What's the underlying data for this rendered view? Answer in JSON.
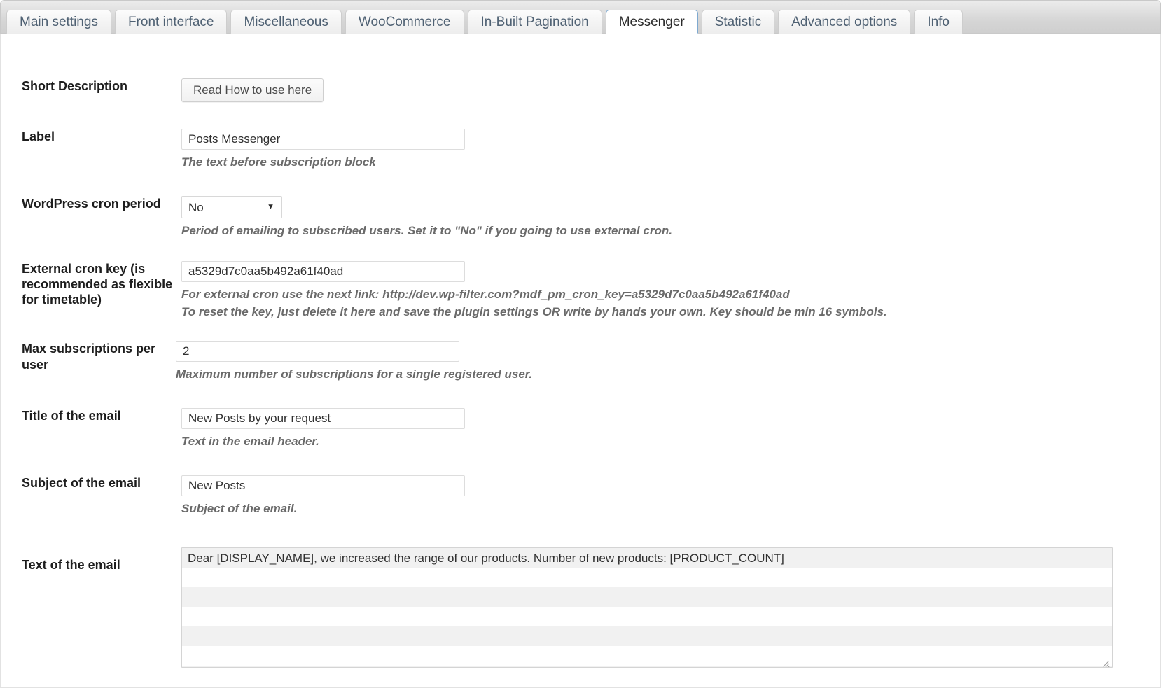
{
  "tabs": [
    {
      "label": "Main settings",
      "active": false
    },
    {
      "label": "Front interface",
      "active": false
    },
    {
      "label": "Miscellaneous",
      "active": false
    },
    {
      "label": "WooCommerce",
      "active": false
    },
    {
      "label": "In-Built Pagination",
      "active": false
    },
    {
      "label": "Messenger",
      "active": true
    },
    {
      "label": "Statistic",
      "active": false
    },
    {
      "label": "Advanced options",
      "active": false
    },
    {
      "label": "Info",
      "active": false
    }
  ],
  "fields": {
    "short_description": {
      "label": "Short Description",
      "button_label": "Read How to use here"
    },
    "label": {
      "label": "Label",
      "value": "Posts Messenger",
      "desc": "The text before subscription block"
    },
    "cron_period": {
      "label": "WordPress cron period",
      "value": "No",
      "options": [
        "No"
      ],
      "desc": "Period of emailing to subscribed users. Set it to \"No\" if you going to use external cron."
    },
    "cron_key": {
      "label": "External cron key (is recommended as flexible for timetable)",
      "value": "a5329d7c0aa5b492a61f40ad",
      "desc_line1": "For external cron use the next link: http://dev.wp-filter.com?mdf_pm_cron_key=a5329d7c0aa5b492a61f40ad",
      "desc_line2": "To reset the key, just delete it here and save the plugin settings OR write by hands your own. Key should be min 16 symbols."
    },
    "max_subscriptions": {
      "label": "Max subscriptions per user",
      "value": "2",
      "desc": "Maximum number of subscriptions for a single registered user."
    },
    "email_title": {
      "label": "Title of the email",
      "value": "New Posts by your request",
      "desc": "Text in the email header."
    },
    "email_subject": {
      "label": "Subject of the email",
      "value": "New Posts",
      "desc": "Subject of the email."
    },
    "email_text": {
      "label": "Text of the email",
      "value": "Dear [DISPLAY_NAME], we increased the range of our products. Number of new products: [PRODUCT_COUNT]"
    }
  },
  "icons": {
    "chevron_down": "▼"
  },
  "colors": {
    "active_tab_border": "#7ea9d0",
    "label_text": "#1d1d1d",
    "desc_text": "#6a6a6a",
    "tab_text": "#4f6173",
    "panel_bg": "#ffffff"
  }
}
